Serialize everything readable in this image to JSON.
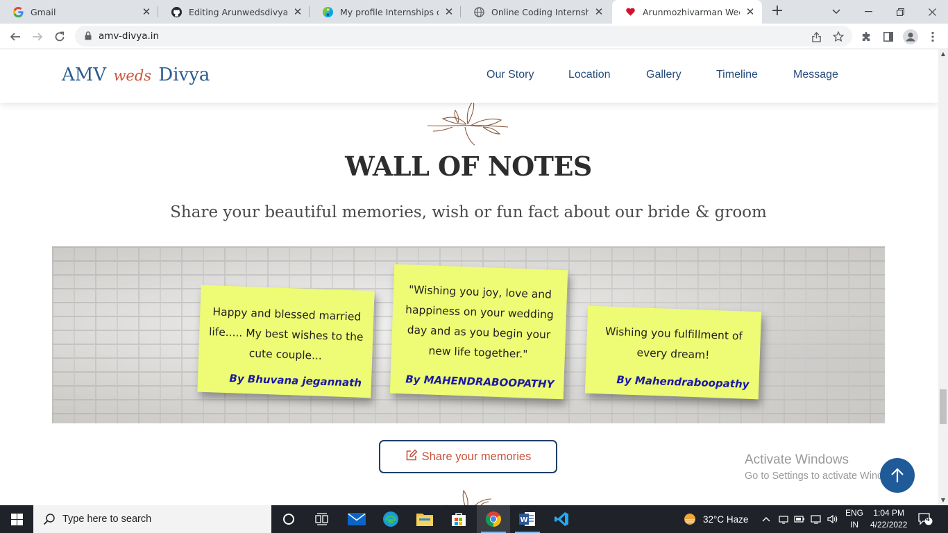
{
  "browser": {
    "tabs": [
      {
        "title": "Gmail",
        "icon": "google-icon"
      },
      {
        "title": "Editing Arunwedsdivya/readme",
        "icon": "github-icon"
      },
      {
        "title": "My profile Internships online",
        "icon": "internshala-icon"
      },
      {
        "title": "Online Coding Internship - Sk",
        "icon": "globe-icon"
      },
      {
        "title": "Arunmozhivarman Weds Divya",
        "icon": "heart-icon",
        "active": true
      }
    ],
    "url": "amv-divya.in"
  },
  "site": {
    "brand": {
      "left": "AMV",
      "middle": "weds",
      "right": "Divya"
    },
    "nav": [
      "Our Story",
      "Location",
      "Gallery",
      "Timeline",
      "Message"
    ],
    "section_title": "WALL OF NOTES",
    "section_subtitle": "Share your beautiful memories, wish or fun fact about our bride & groom",
    "notes": [
      {
        "message": "Happy and blessed married life..... My best wishes to the cute couple...",
        "author": "By Bhuvana jegannath"
      },
      {
        "message": "\"Wishing you joy, love and happiness on your wedding day and as you begin your new life together.\"",
        "author": "By MAHENDRABOOPATHY"
      },
      {
        "message": "Wishing you fulfillment of every dream!",
        "author": "By Mahendraboopathy"
      }
    ],
    "share_button": "Share your memories"
  },
  "watermark": {
    "line1": "Activate Windows",
    "line2": "Go to Settings to activate Windows."
  },
  "taskbar": {
    "search_placeholder": "Type here to search",
    "weather": "32°C  Haze",
    "lang_line1": "ENG",
    "lang_line2": "IN",
    "time": "1:04 PM",
    "date": "4/22/2022",
    "notifications": "4"
  },
  "colors": {
    "brand_blue": "#2a5d8f",
    "accent": "#c9543c",
    "note_yellow": "#eefb74",
    "note_author": "#1a1aa6"
  }
}
